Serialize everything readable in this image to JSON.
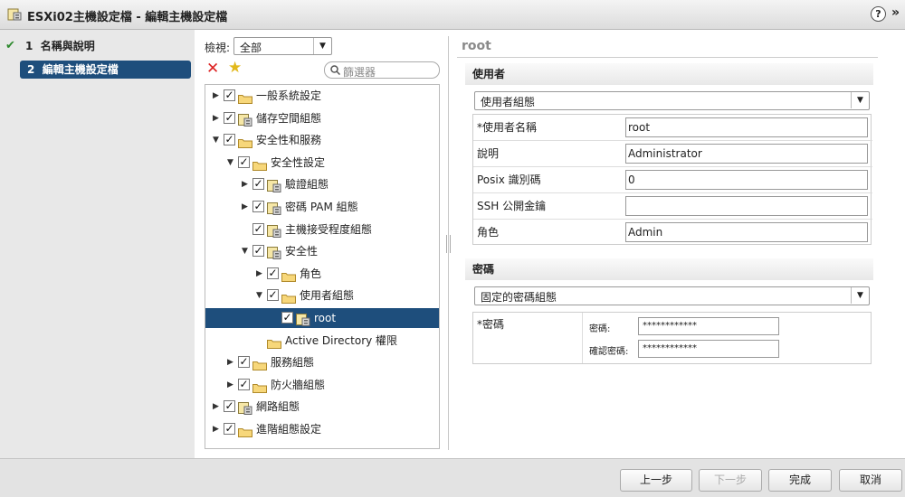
{
  "window": {
    "title": "ESXi02主機設定檔 - 編輯主機設定檔",
    "help_label": "?",
    "close_label": "»"
  },
  "steps": [
    {
      "num": "1",
      "label": "名稱與說明",
      "done_mark": "✔"
    },
    {
      "num": "2",
      "label": "編輯主機設定檔"
    }
  ],
  "filter": {
    "view_label": "檢視:",
    "view_value": "全部",
    "search_placeholder": "篩選器"
  },
  "tree": [
    {
      "label": "一般系統設定",
      "twisty": "▶",
      "check": "✓"
    },
    {
      "label": "儲存空間組態",
      "twisty": "▶",
      "check": "✓"
    },
    {
      "label": "安全性和服務",
      "twisty": "▼",
      "check": "✓"
    },
    {
      "label": "安全性設定",
      "twisty": "▼",
      "check": "✓"
    },
    {
      "label": "驗證組態",
      "twisty": "▶",
      "check": "✓"
    },
    {
      "label": "密碼 PAM 組態",
      "twisty": "▶",
      "check": "✓"
    },
    {
      "label": "主機接受程度組態",
      "twisty": "",
      "check": "✓"
    },
    {
      "label": "安全性",
      "twisty": "▼",
      "check": "✓"
    },
    {
      "label": "角色",
      "twisty": "▶",
      "check": "✓"
    },
    {
      "label": "使用者組態",
      "twisty": "▼",
      "check": "✓"
    },
    {
      "label": "root",
      "twisty": "",
      "check": "✓"
    },
    {
      "label": "Active Directory 權限",
      "twisty": "",
      "check": ""
    },
    {
      "label": "服務組態",
      "twisty": "▶",
      "check": "✓"
    },
    {
      "label": "防火牆組態",
      "twisty": "▶",
      "check": "✓"
    },
    {
      "label": "網路組態",
      "twisty": "▶",
      "check": "✓"
    },
    {
      "label": "進階組態設定",
      "twisty": "▶",
      "check": "✓"
    }
  ],
  "detail": {
    "title": "root",
    "user_section": {
      "header": "使用者",
      "dropdown": "使用者組態",
      "fields": [
        {
          "label": "*使用者名稱",
          "value": "root"
        },
        {
          "label": "說明",
          "value": "Administrator"
        },
        {
          "label": "Posix 識別碼",
          "value": "0"
        },
        {
          "label": "SSH 公開金鑰",
          "value": ""
        },
        {
          "label": "角色",
          "value": "Admin"
        }
      ]
    },
    "password_section": {
      "header": "密碼",
      "dropdown": "固定的密碼組態",
      "row_label": "*密碼",
      "password_label": "密碼:",
      "password_value": "************",
      "confirm_label": "確認密碼:",
      "confirm_value": "************"
    }
  },
  "buttons": {
    "back": "上一步",
    "next": "下一步",
    "finish": "完成",
    "cancel": "取消"
  }
}
